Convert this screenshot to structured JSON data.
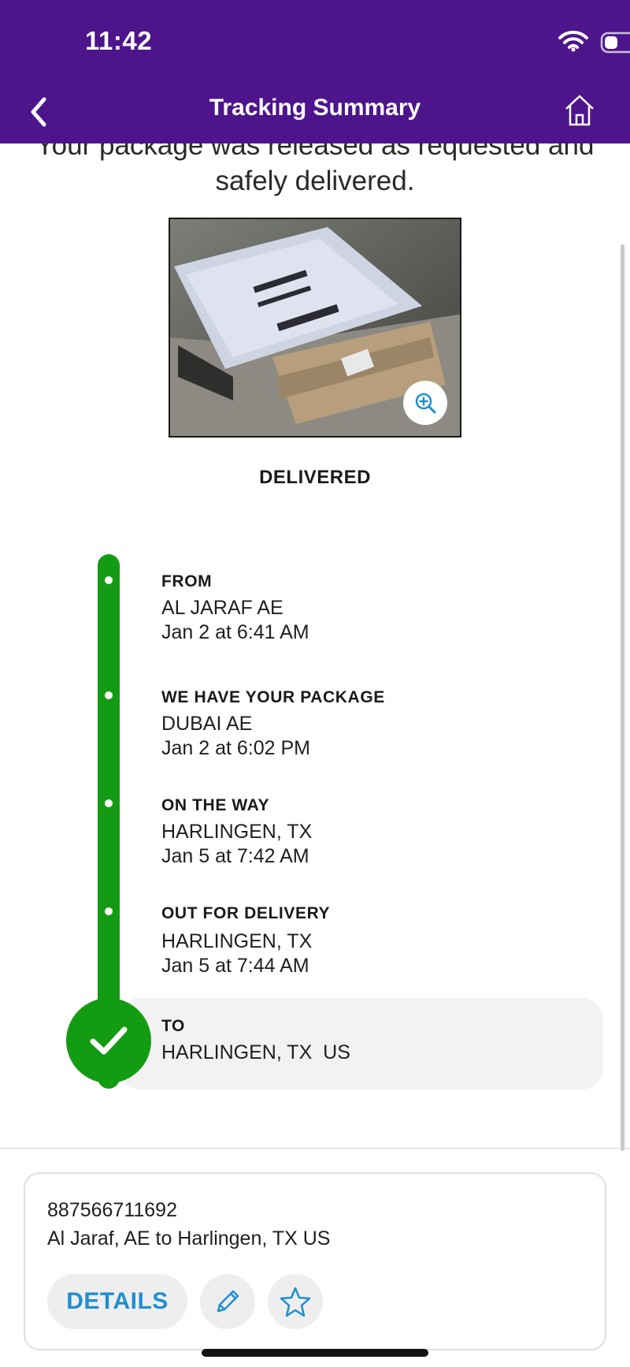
{
  "status_bar": {
    "time": "11:42"
  },
  "nav": {
    "title": "Tracking Summary",
    "back_icon": "chevron-left-icon",
    "home_icon": "home-icon"
  },
  "intro_text": "Your package was released as requested and safely delivered.",
  "photo": {
    "alt": "Photo of delivered package",
    "zoom_icon": "zoom-in-icon"
  },
  "status_heading": "DELIVERED",
  "timeline": [
    {
      "label": "FROM",
      "location": "AL JARAF AE",
      "time": "Jan 2 at 6:41 AM"
    },
    {
      "label": "WE HAVE YOUR PACKAGE",
      "location": "DUBAI AE",
      "time": "Jan 2 at 6:02 PM"
    },
    {
      "label": "ON THE WAY",
      "location": "HARLINGEN, TX",
      "time": "Jan 5 at 7:42 AM"
    },
    {
      "label": "OUT FOR DELIVERY",
      "location": "HARLINGEN, TX",
      "time": "Jan 5 at 7:44 AM"
    },
    {
      "label": "TO",
      "location": "HARLINGEN, TX  US"
    }
  ],
  "card": {
    "tracking_number": "887566711692",
    "route": "Al Jaraf, AE to Harlingen, TX US",
    "details_label": "DETAILS",
    "edit_icon": "pencil-icon",
    "favorite_icon": "star-icon"
  },
  "colors": {
    "header": "#4d148c",
    "timeline": "#139c13",
    "accent": "#1e8fcf"
  }
}
